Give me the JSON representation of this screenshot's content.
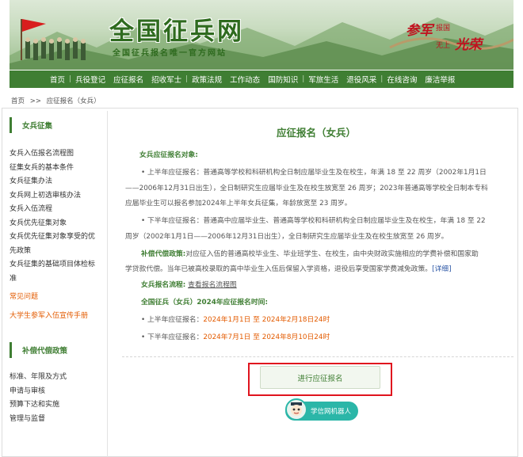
{
  "header": {
    "site_title": "全国征兵网",
    "site_subtitle": "全国征兵报名唯一官方网站",
    "slogan_main_1": "参军",
    "slogan_small_1": "报国",
    "slogan_small_2": "无上",
    "slogan_main_2": "光荣"
  },
  "nav": {
    "items": [
      "首页",
      "兵役登记",
      "应征报名",
      "招收军士",
      "政策法规",
      "工作动态",
      "国防知识",
      "军旅生活",
      "退役风采",
      "在线咨询",
      "廉洁举报"
    ]
  },
  "breadcrumb": {
    "home": "首页",
    "sep": ">>",
    "current": "应征报名（女兵）"
  },
  "sidebar": {
    "section1_title": "女兵征集",
    "section1_links": [
      "女兵入伍报名流程图",
      "征集女兵的基本条件",
      "女兵征集办法",
      "女兵网上初选审核办法",
      "女兵入伍流程",
      "女兵优先征集对象",
      "女兵优先征集对象享受的优",
      "先政策",
      "女兵征集的基础项目体检标",
      "准"
    ],
    "link_faq": "常见问题",
    "link_handbook": "大学生参军入伍宣传手册",
    "section2_title": "补偿代偿政策",
    "section2_links": [
      "标准、年限及方式",
      "申请与审核",
      "预算下达和实施",
      "管理与监督"
    ]
  },
  "main": {
    "title": "应征报名（女兵）",
    "target_heading": "女兵应征报名对象:",
    "first_half_line1": "• 上半年应征报名：普通高等学校和科研机构全日制应届毕业生及在校生，年满 18 至 22 周岁（2002年1月1日",
    "first_half_line2": "——2006年12月31日出生），全日制研究生应届毕业生及在校生放宽至 26 周岁；2023年普通高等学校全日制本专科",
    "first_half_line3": "应届毕业生可以报名参加2024年上半年女兵征集，年龄放宽至 23 周岁。",
    "second_half_line1": "• 下半年应征报名：普通高中应届毕业生、普通高等学校和科研机构全日制应届毕业生及在校生，年满 18 至 22",
    "second_half_line2": "周岁（2002年1月1日——2006年12月31日出生），全日制研究生应届毕业生及在校生放宽至 26 周岁。",
    "comp_label": "补偿代偿政策:",
    "comp_line1": "对应征入伍的普通高校毕业生、毕业班学生、在校生，由中央财政实施相应的学费补偿和国家助",
    "comp_line2": "学贷款代偿。当年已被高校录取的高中毕业生入伍后保留入学资格，退役后享受国家学费减免政策。",
    "comp_details_link": "[详细]",
    "process_label": "女兵报名流程:",
    "process_link": "查看报名流程图",
    "time_heading": "全国征兵（女兵）2024年应征报名时间:",
    "time_first_label": "• 上半年应征报名：",
    "time_first_value": "2024年1月1日 至 2024年2月18日24时",
    "time_second_label": "• 下半年应征报名：",
    "time_second_value": "2024年7月1日 至 2024年8月10日24时",
    "apply_button": "进行应征报名",
    "robot_label": "学信网机器人"
  }
}
